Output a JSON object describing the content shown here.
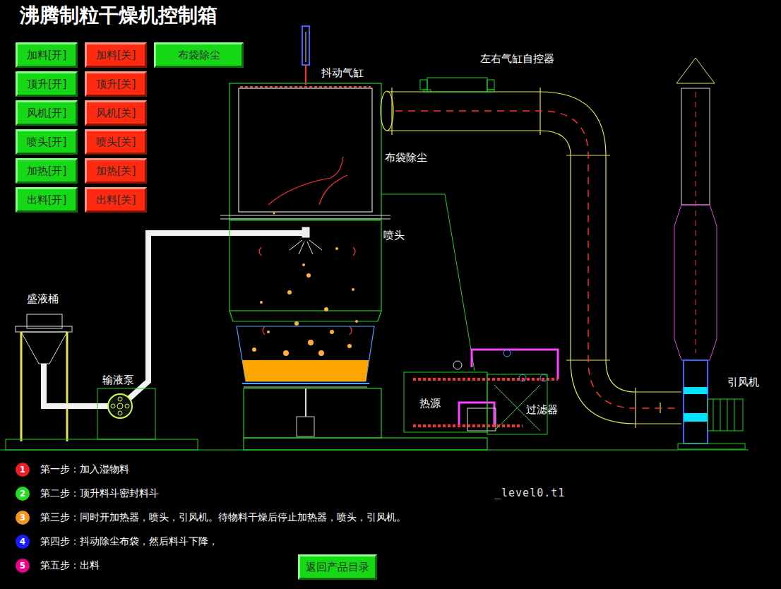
{
  "window": {
    "title": "沸腾制粒干燥机控制箱"
  },
  "control_rows": [
    [
      {
        "label": "加料[开]",
        "kind": "on"
      },
      {
        "label": "加料[关]",
        "kind": "off"
      },
      {
        "label": "布袋除尘",
        "kind": "on"
      }
    ],
    [
      {
        "label": "顶升[开]",
        "kind": "on"
      },
      {
        "label": "顶升[关]",
        "kind": "off"
      }
    ],
    [
      {
        "label": "风机[开]",
        "kind": "on"
      },
      {
        "label": "风机[关]",
        "kind": "off"
      }
    ],
    [
      {
        "label": "喷头[开]",
        "kind": "on"
      },
      {
        "label": "喷头[关]",
        "kind": "off"
      }
    ],
    [
      {
        "label": "加热[开]",
        "kind": "on"
      },
      {
        "label": "加热[关]",
        "kind": "off"
      }
    ],
    [
      {
        "label": "出料[开]",
        "kind": "on"
      },
      {
        "label": "出料[关]",
        "kind": "off"
      }
    ]
  ],
  "diagram": {
    "labels": {
      "cylinder": "抖动气缸",
      "controller": "左右气缸自控器",
      "bag": "布袋除尘",
      "nozzle": "喷头",
      "bucket": "盛液桶",
      "pump": "输液泵",
      "heat": "热源",
      "filter": "过滤器",
      "fan": "引风机"
    },
    "debug_text": "_level0.t1"
  },
  "steps": [
    {
      "number": "1",
      "text": "第一步：加入湿物料",
      "color": "#ee1c25"
    },
    {
      "number": "2",
      "text": "第二步：顶升料斗密封料斗",
      "color": "#22dd22"
    },
    {
      "number": "3",
      "text": "第三步：同时开加热器，喷头，引风机。待物料干燥后停止加热器，喷头，引风机。",
      "color": "#f7941d"
    },
    {
      "number": "4",
      "text": "第四步：抖动除尘布袋，然后料斗下降，",
      "color": "#1a1aff"
    },
    {
      "number": "5",
      "text": "第五步：出料",
      "color": "#ec008c"
    }
  ],
  "return_button": {
    "label": "返回产品目录"
  }
}
